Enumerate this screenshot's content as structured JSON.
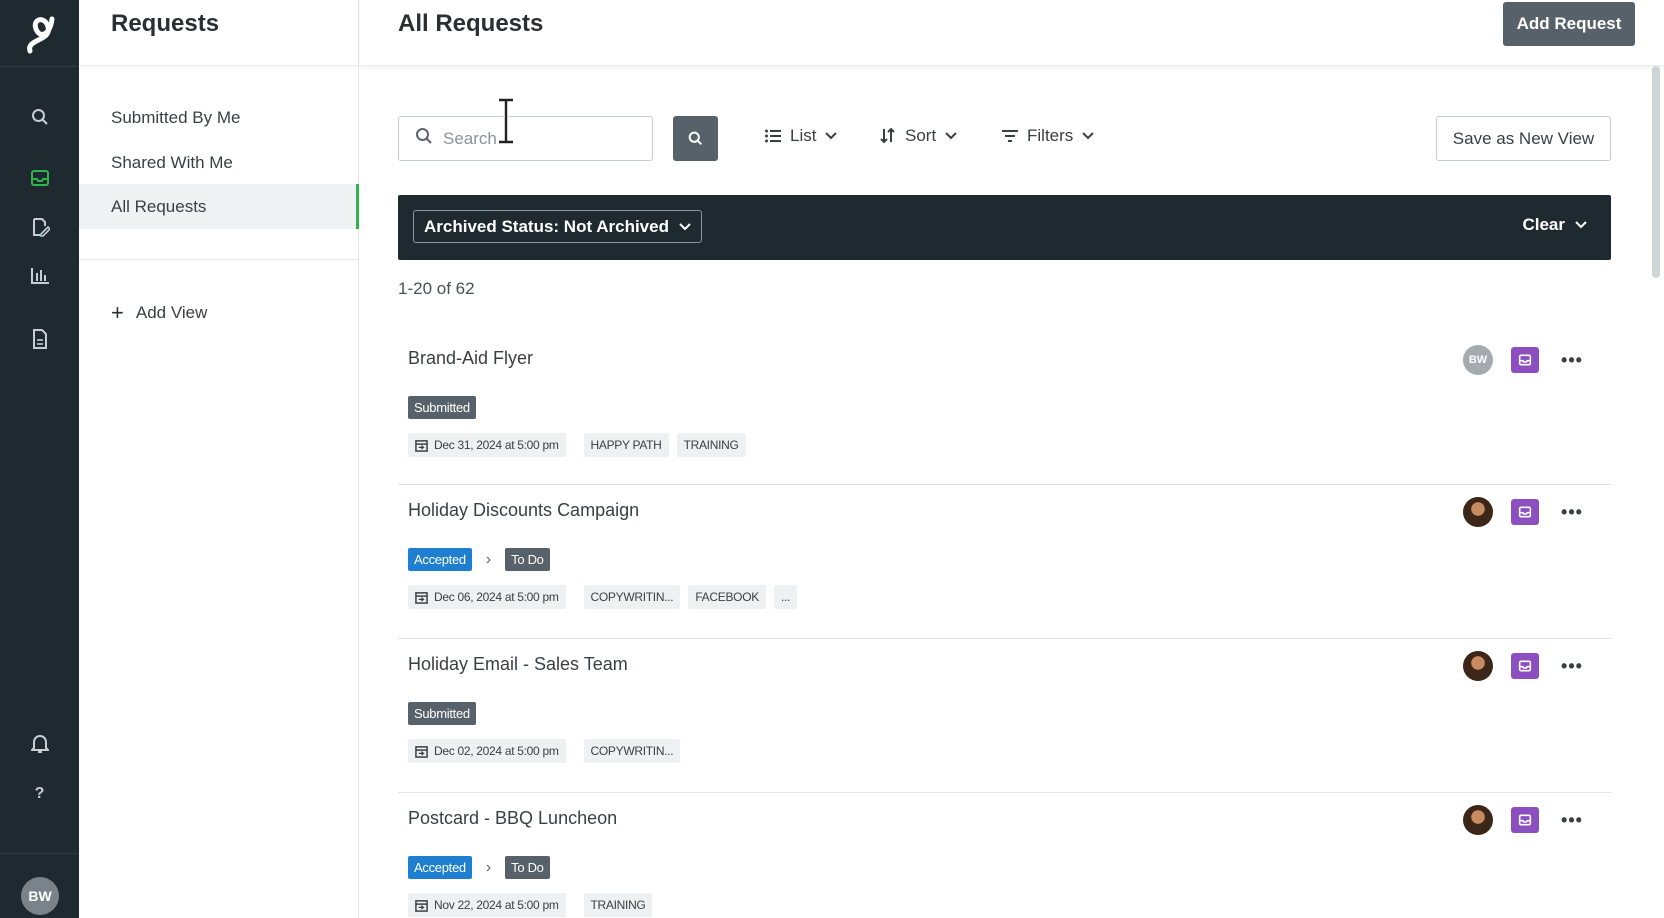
{
  "rail": {
    "icons": [
      "logo-icon",
      "search-icon",
      "inbox-icon",
      "edit-icon",
      "reports-icon",
      "document-icon",
      "notification-icon",
      "help-icon"
    ],
    "user_initials": "BW",
    "help_glyph": "?",
    "active_color": "#2fb64b"
  },
  "sidebar": {
    "title": "Requests",
    "items": [
      {
        "label": "Submitted By Me"
      },
      {
        "label": "Shared With Me"
      },
      {
        "label": "All Requests",
        "active": true
      }
    ],
    "add_view_label": "Add View"
  },
  "header": {
    "title": "All Requests",
    "add_button": "Add Request"
  },
  "toolbar": {
    "search_placeholder": "Search",
    "list_label": "List",
    "sort_label": "Sort",
    "filters_label": "Filters",
    "save_view_label": "Save as New View"
  },
  "filter_bar": {
    "chip_label": "Archived Status: Not Archived",
    "clear_label": "Clear"
  },
  "results": {
    "count_label": "1-20 of 62"
  },
  "requests": [
    {
      "name": "Brand-Aid Flyer",
      "status": "Submitted",
      "date": "Dec 31, 2024 at 5:00 pm",
      "tags": [
        "HAPPY PATH",
        "TRAINING"
      ],
      "assignee": "BW"
    },
    {
      "name": "Holiday Discounts Campaign",
      "status": "Accepted",
      "stage": "To Do",
      "date": "Dec 06, 2024 at 5:00 pm",
      "tags": [
        "COPYWRITIN...",
        "FACEBOOK",
        "..."
      ]
    },
    {
      "name": "Holiday Email - Sales Team",
      "status": "Submitted",
      "date": "Dec 02, 2024 at 5:00 pm",
      "tags": [
        "COPYWRITIN..."
      ]
    },
    {
      "name": "Postcard - BBQ Luncheon",
      "status": "Accepted",
      "stage": "To Do",
      "date": "Nov 22, 2024 at 5:00 pm",
      "tags": [
        "TRAINING"
      ]
    }
  ],
  "colors": {
    "rail_bg": "#1f2a30",
    "primary_button": "#566169",
    "accepted_badge": "#1e7ed0",
    "inbox_badge": "#8c4fbf"
  }
}
